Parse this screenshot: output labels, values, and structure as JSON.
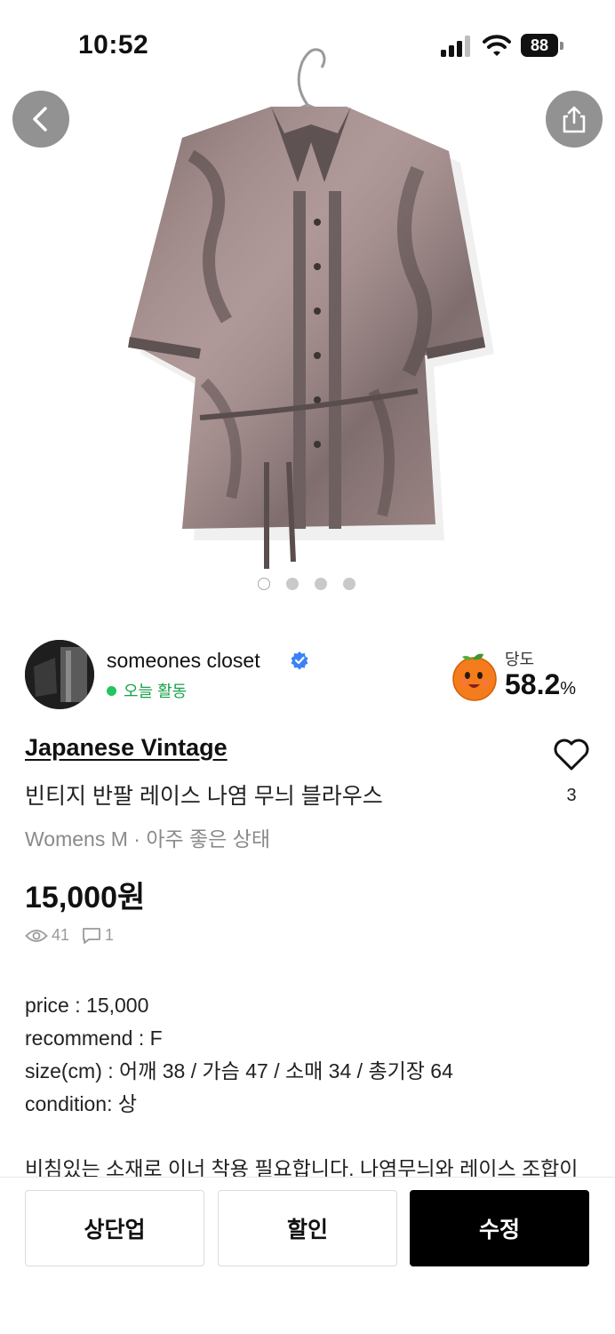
{
  "status_bar": {
    "time": "10:52",
    "battery": "88",
    "icons": [
      "signal-icon",
      "wifi-icon",
      "battery-icon"
    ]
  },
  "hero": {
    "image_description_icon": "product-photo",
    "carousel_pages": 4,
    "carousel_active": 1,
    "icons": [
      "back-arrow-icon",
      "share-icon"
    ]
  },
  "seller": {
    "name": "someones closet",
    "activity": "오늘 활동",
    "sweetness_label": "당도",
    "sweetness_value": "58.2",
    "sweetness_unit": "%",
    "icons": [
      "verified-badge-icon",
      "orange-icon"
    ]
  },
  "product": {
    "brand": "Japanese Vintage",
    "title": "빈티지 반팔 레이스 나염 무늬 블라우스",
    "meta": "Womens M · 아주 좋은 상태",
    "price": "15,000원",
    "likes": "3",
    "views": "41",
    "comments": "1",
    "icons": [
      "heart-icon",
      "eye-icon",
      "comment-icon"
    ]
  },
  "description": {
    "lines": [
      "price : 15,000",
      "recommend : F",
      "size(cm) : 어깨 38 / 가슴 47 / 소매 34 / 총기장 64",
      "condition: 상"
    ],
    "extra": "비침있는 소재로 이너 착용 필요합니다. 나염무늬와 레이스 조합이"
  },
  "actions": {
    "bump": "상단업",
    "discount": "할인",
    "edit": "수정"
  },
  "colors": {
    "accent": "#000000",
    "active_green": "#22c55e",
    "verified_blue": "#3b82f6",
    "muted": "#8a8a8a"
  }
}
